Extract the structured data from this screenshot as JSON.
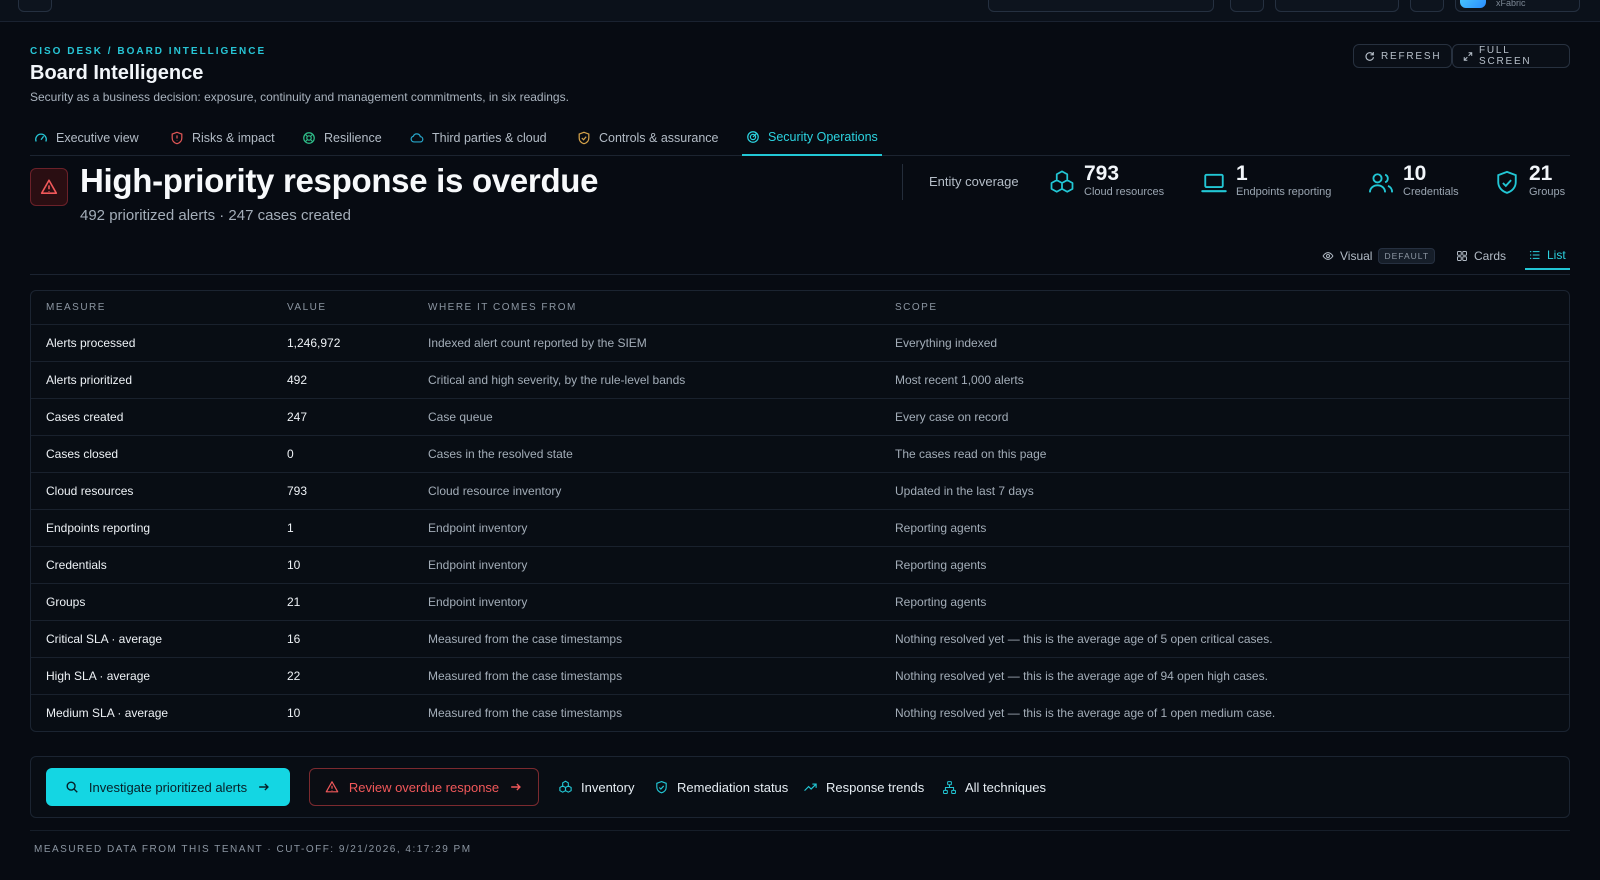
{
  "header": {
    "breadcrumb": "CISO DESK / BOARD INTELLIGENCE",
    "title": "Board Intelligence",
    "subtitle": "Security as a business decision: exposure, continuity and management commitments, in six readings.",
    "refresh_label": "REFRESH",
    "fullscreen_label": "FULL SCREEN",
    "top_right_text": "xFabric"
  },
  "tabs": [
    {
      "label": "Executive view",
      "icon": "gauge-icon"
    },
    {
      "label": "Risks & impact",
      "icon": "shield-alert-icon"
    },
    {
      "label": "Resilience",
      "icon": "lifebuoy-icon"
    },
    {
      "label": "Third parties & cloud",
      "icon": "cloud-icon"
    },
    {
      "label": "Controls & assurance",
      "icon": "shield-check-icon"
    },
    {
      "label": "Security Operations",
      "icon": "radar-icon",
      "active": true
    }
  ],
  "hero": {
    "title": "High-priority response is overdue",
    "subtitle": "492 prioritized alerts · 247 cases created"
  },
  "coverage": {
    "label": "Entity coverage",
    "stats": [
      {
        "value": "793",
        "label": "Cloud resources",
        "icon": "boxes-icon"
      },
      {
        "value": "1",
        "label": "Endpoints reporting",
        "icon": "laptop-icon"
      },
      {
        "value": "10",
        "label": "Credentials",
        "icon": "users-icon"
      },
      {
        "value": "21",
        "label": "Groups",
        "icon": "shield-check-icon"
      }
    ]
  },
  "views": {
    "visual": "Visual",
    "visual_badge": "DEFAULT",
    "cards": "Cards",
    "list": "List",
    "active": "List"
  },
  "table": {
    "headers": [
      "MEASURE",
      "VALUE",
      "WHERE IT COMES FROM",
      "SCOPE"
    ],
    "rows": [
      [
        "Alerts processed",
        "1,246,972",
        "Indexed alert count reported by the SIEM",
        "Everything indexed"
      ],
      [
        "Alerts prioritized",
        "492",
        "Critical and high severity, by the rule-level bands",
        "Most recent 1,000 alerts"
      ],
      [
        "Cases created",
        "247",
        "Case queue",
        "Every case on record"
      ],
      [
        "Cases closed",
        "0",
        "Cases in the resolved state",
        "The cases read on this page"
      ],
      [
        "Cloud resources",
        "793",
        "Cloud resource inventory",
        "Updated in the last 7 days"
      ],
      [
        "Endpoints reporting",
        "1",
        "Endpoint inventory",
        "Reporting agents"
      ],
      [
        "Credentials",
        "10",
        "Endpoint inventory",
        "Reporting agents"
      ],
      [
        "Groups",
        "21",
        "Endpoint inventory",
        "Reporting agents"
      ],
      [
        "Critical SLA · average",
        "16",
        "Measured from the case timestamps",
        "Nothing resolved yet — this is the average age of 5 open critical cases."
      ],
      [
        "High SLA · average",
        "22",
        "Measured from the case timestamps",
        "Nothing resolved yet — this is the average age of 94 open high cases."
      ],
      [
        "Medium SLA · average",
        "10",
        "Measured from the case timestamps",
        "Nothing resolved yet — this is the average age of 1 open medium case."
      ]
    ]
  },
  "actions": {
    "primary": "Investigate prioritized alerts",
    "danger": "Review overdue response",
    "links": [
      {
        "label": "Inventory",
        "icon": "boxes-icon"
      },
      {
        "label": "Remediation status",
        "icon": "shield-check-icon"
      },
      {
        "label": "Response trends",
        "icon": "trend-up-icon"
      },
      {
        "label": "All techniques",
        "icon": "network-icon"
      }
    ]
  },
  "footer": "MEASURED DATA FROM THIS TENANT · CUT-OFF: 9/21/2026, 4:17:29 PM",
  "colors": {
    "accent": "#22c7d5",
    "danger": "#f1585a",
    "background": "#070b12"
  }
}
